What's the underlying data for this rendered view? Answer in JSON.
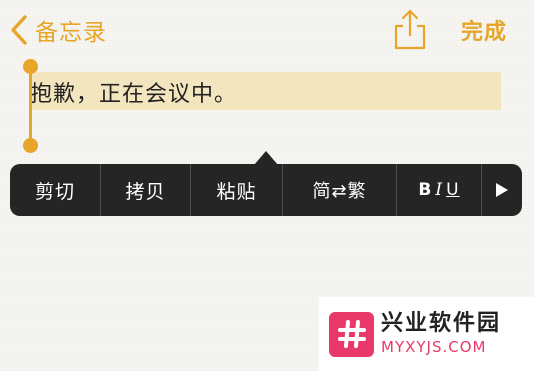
{
  "nav": {
    "back_label": "备忘录",
    "done_label": "完成",
    "share_icon": "share-icon",
    "back_icon": "chevron-left-icon"
  },
  "note": {
    "text": "抱歉，正在会议中。"
  },
  "edit_menu": {
    "items": [
      {
        "label": "剪切"
      },
      {
        "label": "拷贝"
      },
      {
        "label": "粘贴"
      },
      {
        "label": "简⇄繁"
      }
    ],
    "format": {
      "bold": "B",
      "italic": "I",
      "underline": "U"
    },
    "more_icon": "play-icon"
  },
  "watermark": {
    "name": "兴业软件园",
    "domain": "MYXYJS.COM",
    "logo_icon": "hash-icon"
  },
  "colors": {
    "accent": "#e7a52a",
    "selection": "#f3e5bd",
    "menu_bg": "#252525",
    "watermark_accent": "#e8396a"
  }
}
